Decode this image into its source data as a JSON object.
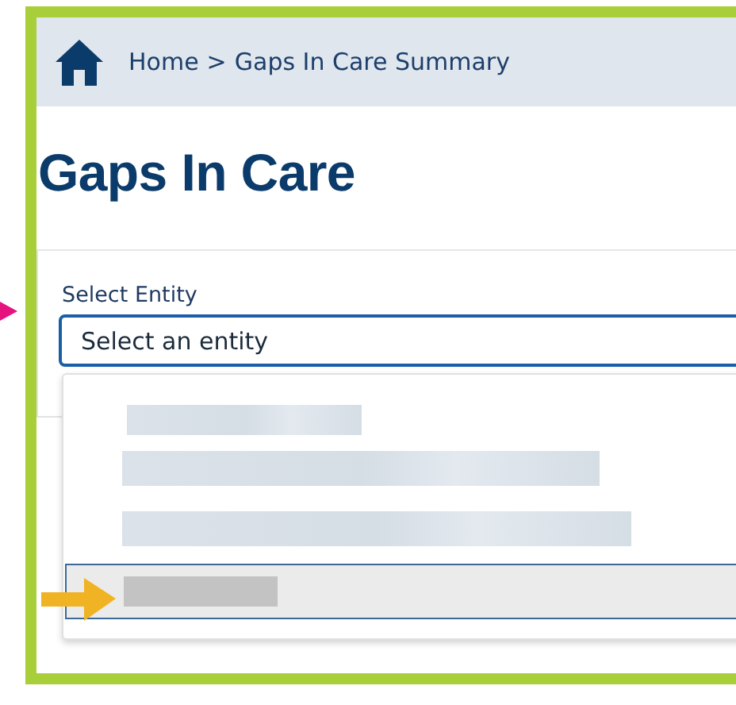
{
  "breadcrumb": {
    "items": [
      "Home",
      "Gaps In Care Summary"
    ],
    "separator": ">"
  },
  "title": "Gaps In Care",
  "entity_select": {
    "label": "Select Entity",
    "placeholder": "Select an entity",
    "expanded": true,
    "options": [
      {
        "selected": false
      },
      {
        "selected": false
      },
      {
        "selected": false
      },
      {
        "selected": true
      }
    ]
  }
}
